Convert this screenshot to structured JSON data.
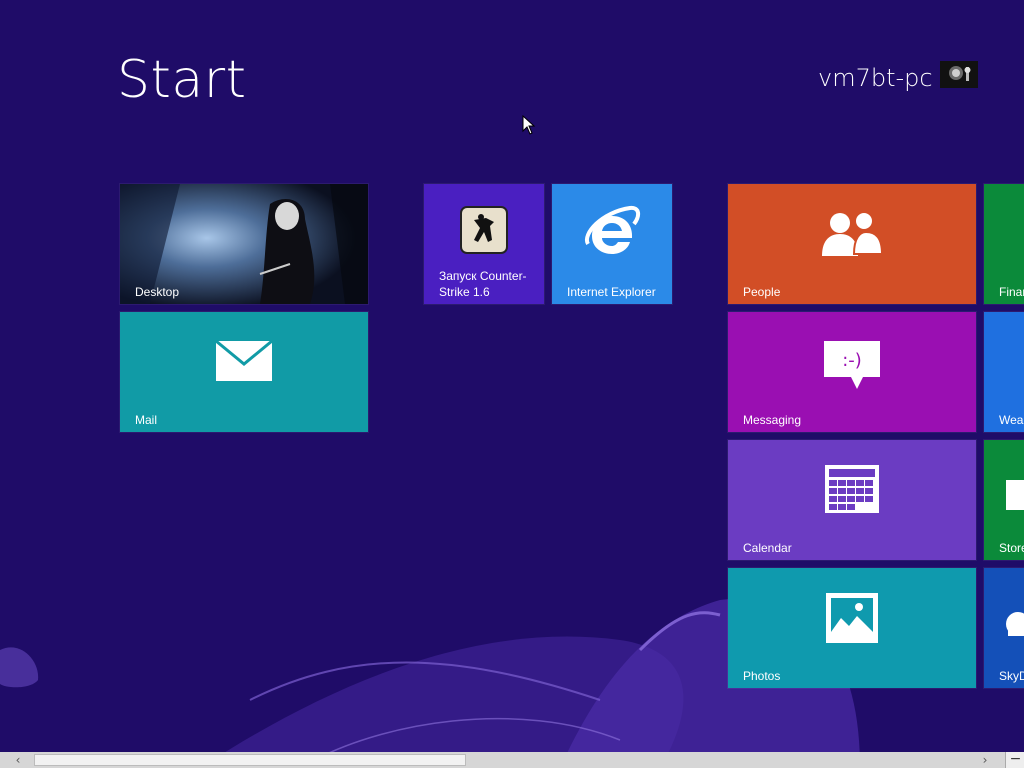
{
  "header": {
    "title": "Start",
    "user_name": "vm7bt-pc"
  },
  "colors": {
    "background": "#1f0c68",
    "desktop": "#1a2640",
    "mail": "#119ba6",
    "counter_strike": "#4a1fc1",
    "internet_explorer": "#2b8ae8",
    "people": "#d24e26",
    "messaging": "#9a0fb2",
    "calendar": "#6b3cc2",
    "photos": "#0f9aae",
    "finance": "#0b8a3a",
    "weather": "#1f70e0",
    "store": "#0b8a3a",
    "skydrive": "#1450b8"
  },
  "tiles": [
    {
      "label": "Desktop",
      "icon": "desktop-wallpaper-image"
    },
    {
      "label": "Mail",
      "icon": "envelope-icon"
    },
    {
      "label": "Запуск Counter-Strike 1.6",
      "icon": "counter-strike-icon"
    },
    {
      "label": "Internet Explorer",
      "icon": "internet-explorer-icon"
    },
    {
      "label": "People",
      "icon": "people-icon"
    },
    {
      "label": "Messaging",
      "icon": "speech-bubble-icon"
    },
    {
      "label": "Calendar",
      "icon": "calendar-icon"
    },
    {
      "label": "Photos",
      "icon": "photo-icon"
    },
    {
      "label": "Finar",
      "icon": "finance-icon"
    },
    {
      "label": "Wea",
      "icon": "weather-icon"
    },
    {
      "label": "Store",
      "icon": "store-icon"
    },
    {
      "label": "SkyD",
      "icon": "cloud-icon"
    }
  ],
  "scrollbar": {
    "left_arrow": "‹",
    "right_arrow": "›",
    "zoom_label": "−",
    "position": 0.03
  }
}
